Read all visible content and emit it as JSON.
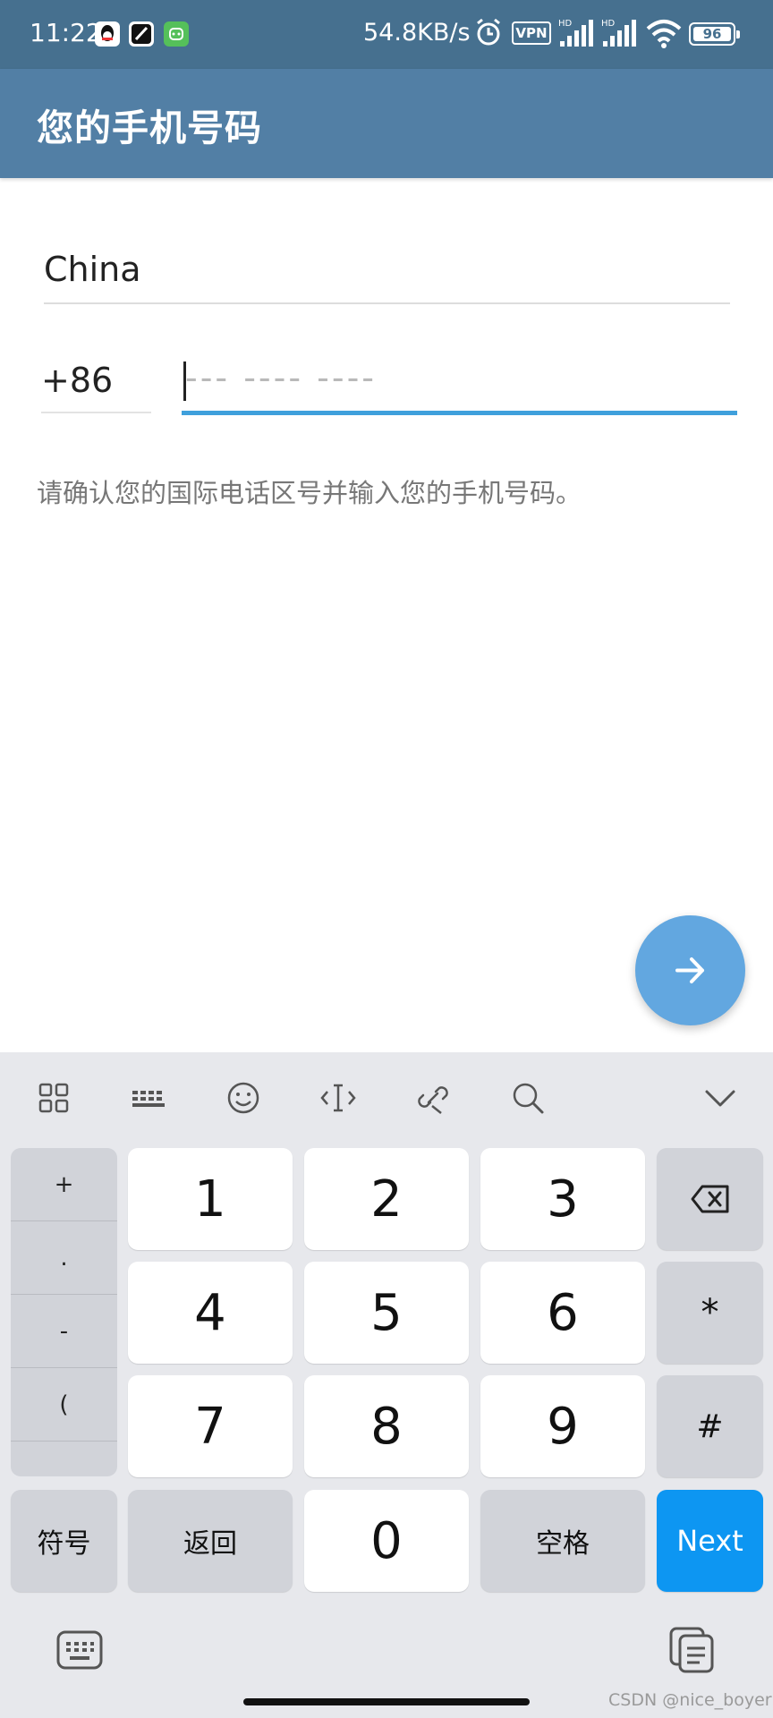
{
  "status_bar": {
    "time": "11:22",
    "net_speed": "54.8KB/s",
    "vpn_label": "VPN",
    "signal_label": "HD",
    "battery": "96",
    "app_icons": [
      "qq-icon",
      "notes-icon",
      "wechat-bot-icon"
    ]
  },
  "app_bar": {
    "title": "您的手机号码"
  },
  "form": {
    "country": "China",
    "country_code": "+86",
    "phone_value": "",
    "phone_placeholder": "--- ---- ----",
    "hint": "请确认您的国际电话区号并输入您的手机号码。"
  },
  "fab": {
    "icon": "arrow-right-icon"
  },
  "keyboard": {
    "toolbar": [
      "grid-apps-icon",
      "keyboard-layout-icon",
      "emoji-icon",
      "cursor-move-icon",
      "clipboard-link-icon",
      "search-icon",
      "collapse-chevron-icon"
    ],
    "side_keys": [
      "+",
      ".",
      "-",
      "(",
      ""
    ],
    "digits": [
      "1",
      "2",
      "3",
      "4",
      "5",
      "6",
      "7",
      "8",
      "9"
    ],
    "zero": "0",
    "star": "*",
    "hash": "#",
    "symbols_label": "符号",
    "back_label": "返回",
    "space_label": "空格",
    "next_label": "Next"
  },
  "footer": {
    "watermark": "CSDN @nice_boyer"
  }
}
